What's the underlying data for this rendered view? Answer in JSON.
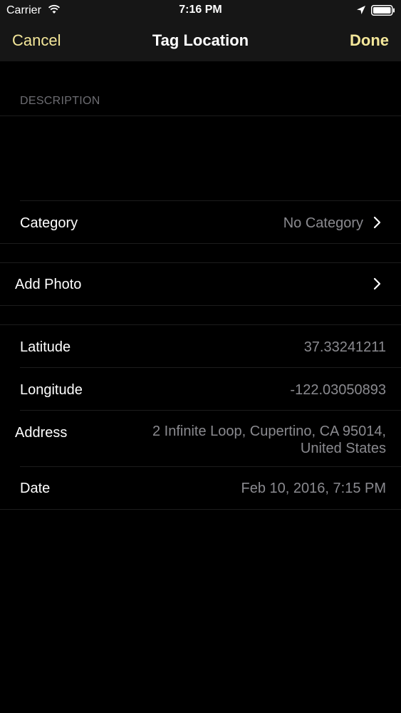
{
  "status_bar": {
    "carrier": "Carrier",
    "time": "7:16 PM"
  },
  "nav": {
    "cancel": "Cancel",
    "title": "Tag Location",
    "done": "Done"
  },
  "description": {
    "header": "DESCRIPTION",
    "value": ""
  },
  "category": {
    "label": "Category",
    "value": "No Category"
  },
  "add_photo": {
    "label": "Add Photo"
  },
  "details": {
    "latitude_label": "Latitude",
    "latitude_value": "37.33241211",
    "longitude_label": "Longitude",
    "longitude_value": "-122.03050893",
    "address_label": "Address",
    "address_line1": "2 Infinite Loop, Cupertino, CA 95014,",
    "address_line2": "United States",
    "date_label": "Date",
    "date_value": "Feb 10, 2016, 7:15 PM"
  },
  "colors": {
    "accent": "#f4e79a",
    "background": "#000000",
    "bar": "#161616",
    "secondary_text": "#8a8a8f"
  },
  "icons": [
    "wifi-icon",
    "location-arrow-icon",
    "battery-icon",
    "chevron-right-icon"
  ]
}
